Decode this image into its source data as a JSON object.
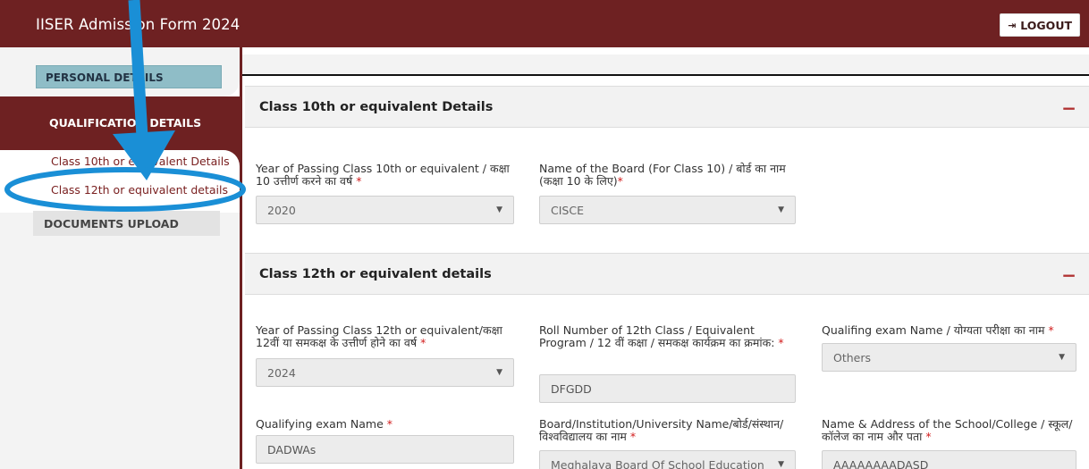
{
  "header": {
    "title": "IISER Admission Form 2024",
    "logout_label": "LOGOUT"
  },
  "sidebar": {
    "personal": "PERSONAL DETAILS",
    "qualification": "QUALIFICATION DETAILS",
    "sub_items": [
      "Class 10th or equivalent Details",
      "Class 12th or equivalent details"
    ],
    "documents": "DOCUMENTS UPLOAD"
  },
  "class10": {
    "title": "Class 10th or equivalent Details",
    "collapse": "−",
    "year_label": "Year of Passing Class 10th or equivalent / कक्षा 10 उत्तीर्ण करने का वर्ष",
    "year_value": "2020",
    "board_label": "Name of the Board (For Class 10) / बोर्ड का नाम (कक्षा 10 के लिए)",
    "board_value": "CISCE"
  },
  "class12": {
    "title": "Class 12th or equivalent details",
    "collapse": "−",
    "year_label": "Year of Passing Class 12th or equivalent/कक्षा 12वीं या समकक्ष के उत्तीर्ण होने का वर्ष",
    "year_value": "2024",
    "roll_label": "Roll Number of 12th Class / Equivalent Program / 12 वीं कक्षा / समकक्ष कार्यक्रम का क्रमांक:",
    "roll_value": "DFGDD",
    "exam_label": "Qualifing exam Name / योग्यता परीक्षा का नाम",
    "exam_value": "Others",
    "qual_name_label": "Qualifying exam Name",
    "qual_name_value": "DADWAs",
    "board_label": "Board/Institution/University Name/बोर्ड/संस्थान/विश्वविद्यालय का नाम",
    "board_value": "Meghalaya Board Of School Education",
    "school_label": "Name & Address of the School/College / स्कूल/कॉलेज का नाम और पता",
    "school_value": "AAAAAAAADASD"
  },
  "required_mark": "*",
  "colors": {
    "brand": "#6e2122",
    "annotation": "#1a8fd6",
    "required": "#d21c1c"
  }
}
